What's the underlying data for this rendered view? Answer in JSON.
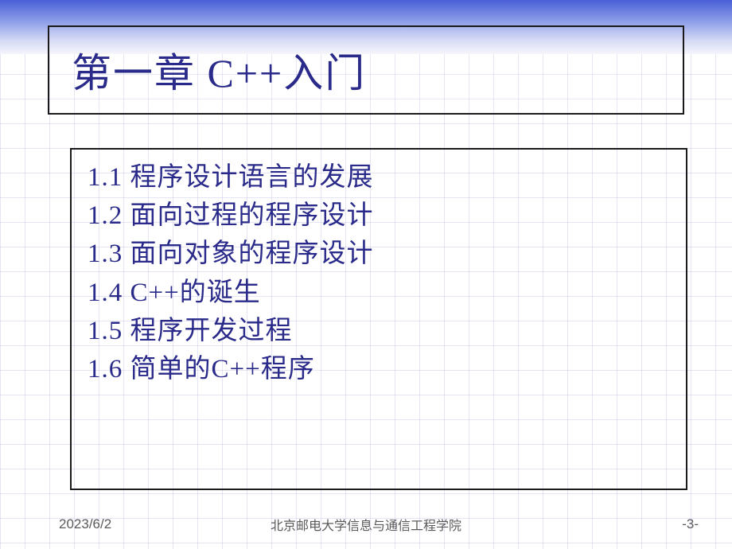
{
  "title": "第一章 C++入门",
  "content": {
    "items": [
      "1.1 程序设计语言的发展",
      "1.2 面向过程的程序设计",
      "1.3 面向对象的程序设计",
      "1.4 C++的诞生",
      "1.5 程序开发过程",
      "1.6 简单的C++程序"
    ]
  },
  "footer": {
    "date": "2023/6/2",
    "organization": "北京邮电大学信息与通信工程学院",
    "page": "-3-"
  }
}
